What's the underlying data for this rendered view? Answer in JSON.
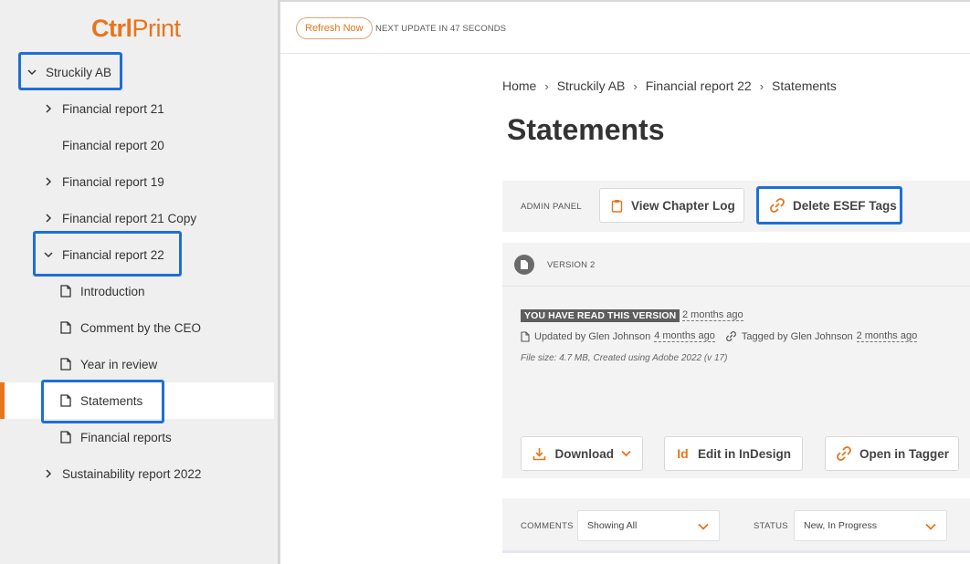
{
  "logo": {
    "part1": "Ctrl",
    "part2": "Print"
  },
  "topbar": {
    "refresh_label": "Refresh Now",
    "update_text": "NEXT UPDATE IN 47 SECONDS"
  },
  "sidebar": {
    "items": [
      {
        "label": "Struckily AB",
        "kind": "folder",
        "expanded": true
      },
      {
        "label": "Financial report 21",
        "kind": "folder",
        "expanded": false
      },
      {
        "label": "Financial report 20",
        "kind": "leaf"
      },
      {
        "label": "Financial report 19",
        "kind": "folder",
        "expanded": false
      },
      {
        "label": "Financial report 21 Copy",
        "kind": "folder",
        "expanded": false
      },
      {
        "label": "Financial report 22",
        "kind": "folder",
        "expanded": true
      },
      {
        "label": "Introduction",
        "kind": "document"
      },
      {
        "label": "Comment by the CEO",
        "kind": "document"
      },
      {
        "label": "Year in review",
        "kind": "document"
      },
      {
        "label": "Statements",
        "kind": "document",
        "active": true
      },
      {
        "label": "Financial reports",
        "kind": "document"
      },
      {
        "label": "Sustainability report 2022",
        "kind": "folder",
        "expanded": false
      }
    ]
  },
  "breadcrumb": [
    "Home",
    "Struckily AB",
    "Financial report 22",
    "Statements"
  ],
  "page_title": "Statements",
  "admin_panel": {
    "label": "ADMIN PANEL",
    "view_log_label": "View Chapter Log",
    "delete_tags_label": "Delete ESEF Tags"
  },
  "version": {
    "label": "VERSION 2",
    "read_badge": "YOU HAVE READ THIS VERSION",
    "read_time": "2 months ago",
    "updated_prefix": "Updated by Glen Johnson",
    "updated_time": "4 months ago",
    "tagged_prefix": "Tagged by Glen Johnson",
    "tagged_time": "2 months ago",
    "file_info": "File size: 4.7 MB, Created using Adobe 2022 (v 17)",
    "download_label": "Download",
    "indesign_label": "Edit in InDesign",
    "tagger_label": "Open in Tagger"
  },
  "comments": {
    "label": "COMMENTS",
    "filter_value": "Showing All",
    "status_label": "STATUS",
    "status_value": "New, In Progress"
  },
  "colors": {
    "accent": "#e8751a",
    "highlight": "#1d6fd6",
    "panel": "#f3f3f3"
  }
}
